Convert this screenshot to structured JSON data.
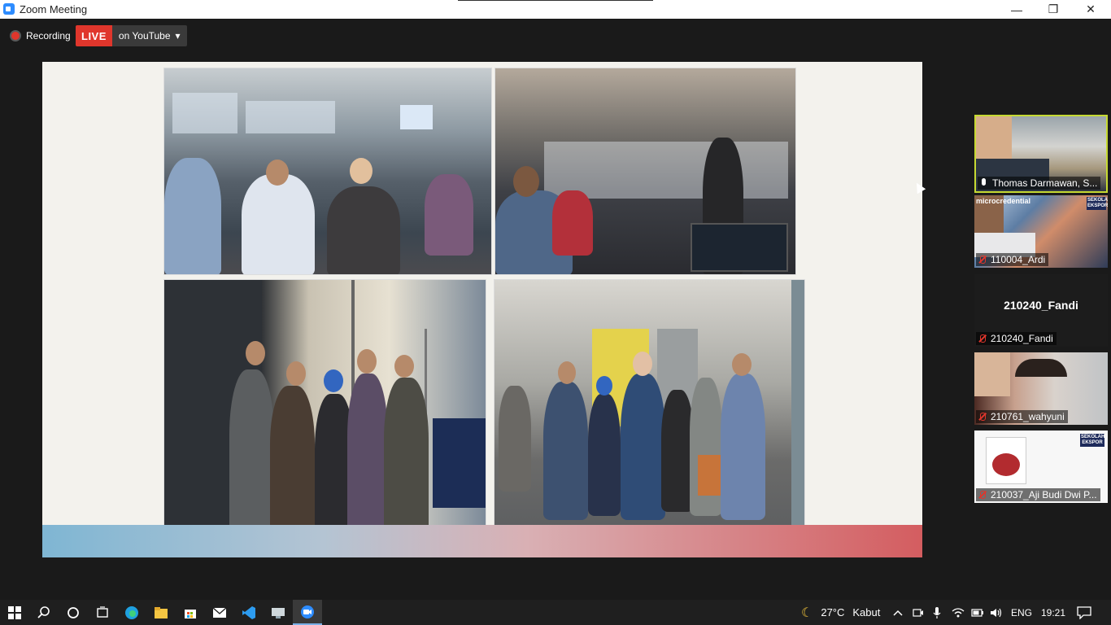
{
  "window": {
    "title": "Zoom Meeting",
    "minimize": "—",
    "restore": "❐",
    "close": "✕"
  },
  "recording": {
    "label": "Recording"
  },
  "live": {
    "badge": "LIVE",
    "platform": "on YouTube",
    "caret": "▾"
  },
  "participants": [
    {
      "name": "Thomas Darmawan, S...",
      "muted": false,
      "active_speaker": true
    },
    {
      "name": "110004_Ardi",
      "muted": true
    },
    {
      "name": "210240_Fandi",
      "muted": true,
      "video_off_label": "210240_Fandi"
    },
    {
      "name": "210761_wahyuni",
      "muted": true
    },
    {
      "name": "210037_Aji Budi Dwi P...",
      "muted": true
    }
  ],
  "tile_branding": {
    "sekolah_ekspor": "SEKOLAH EKSPOR",
    "microcredential": "microcredential"
  },
  "taskbar": {
    "weather_temp": "27°C",
    "weather_desc": "Kabut",
    "language": "ENG",
    "time": "19:21"
  },
  "colors": {
    "accent_live": "#e0362c",
    "active_speaker_border": "#c6d932",
    "zoom_blue": "#2d8cff"
  }
}
